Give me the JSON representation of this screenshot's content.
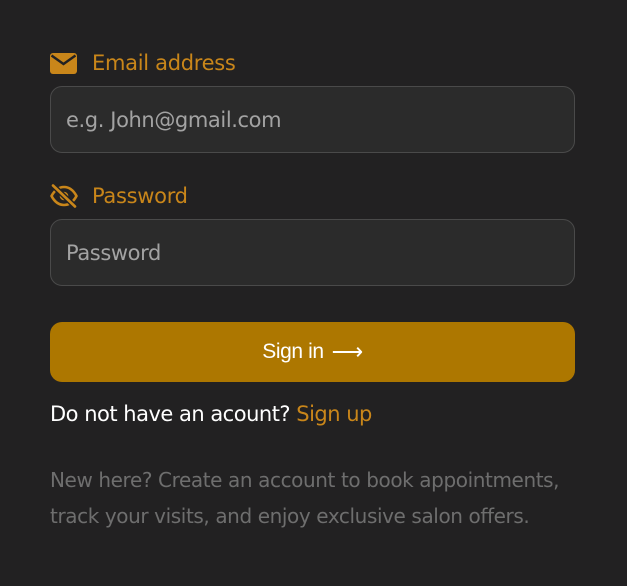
{
  "email": {
    "label": "Email address",
    "icon": "envelope-icon",
    "placeholder": "e.g. John@gmail.com",
    "value": ""
  },
  "password": {
    "label": "Password",
    "icon": "eye-slash-icon",
    "placeholder": "Password",
    "value": ""
  },
  "signin": {
    "label": "Sign in",
    "arrow": "⟶"
  },
  "signup": {
    "prompt": "Do not have an acount?",
    "link": "Sign up"
  },
  "note": "New here? Create an account to book appointments, track your visits, and enjoy exclusive salon offers.",
  "colors": {
    "background": "#222122",
    "accent": "#c9861a",
    "button": "#ad7700",
    "field_bg": "#2b2b2b",
    "field_border": "#4a4a4a",
    "muted_text": "#6e6e6e"
  }
}
